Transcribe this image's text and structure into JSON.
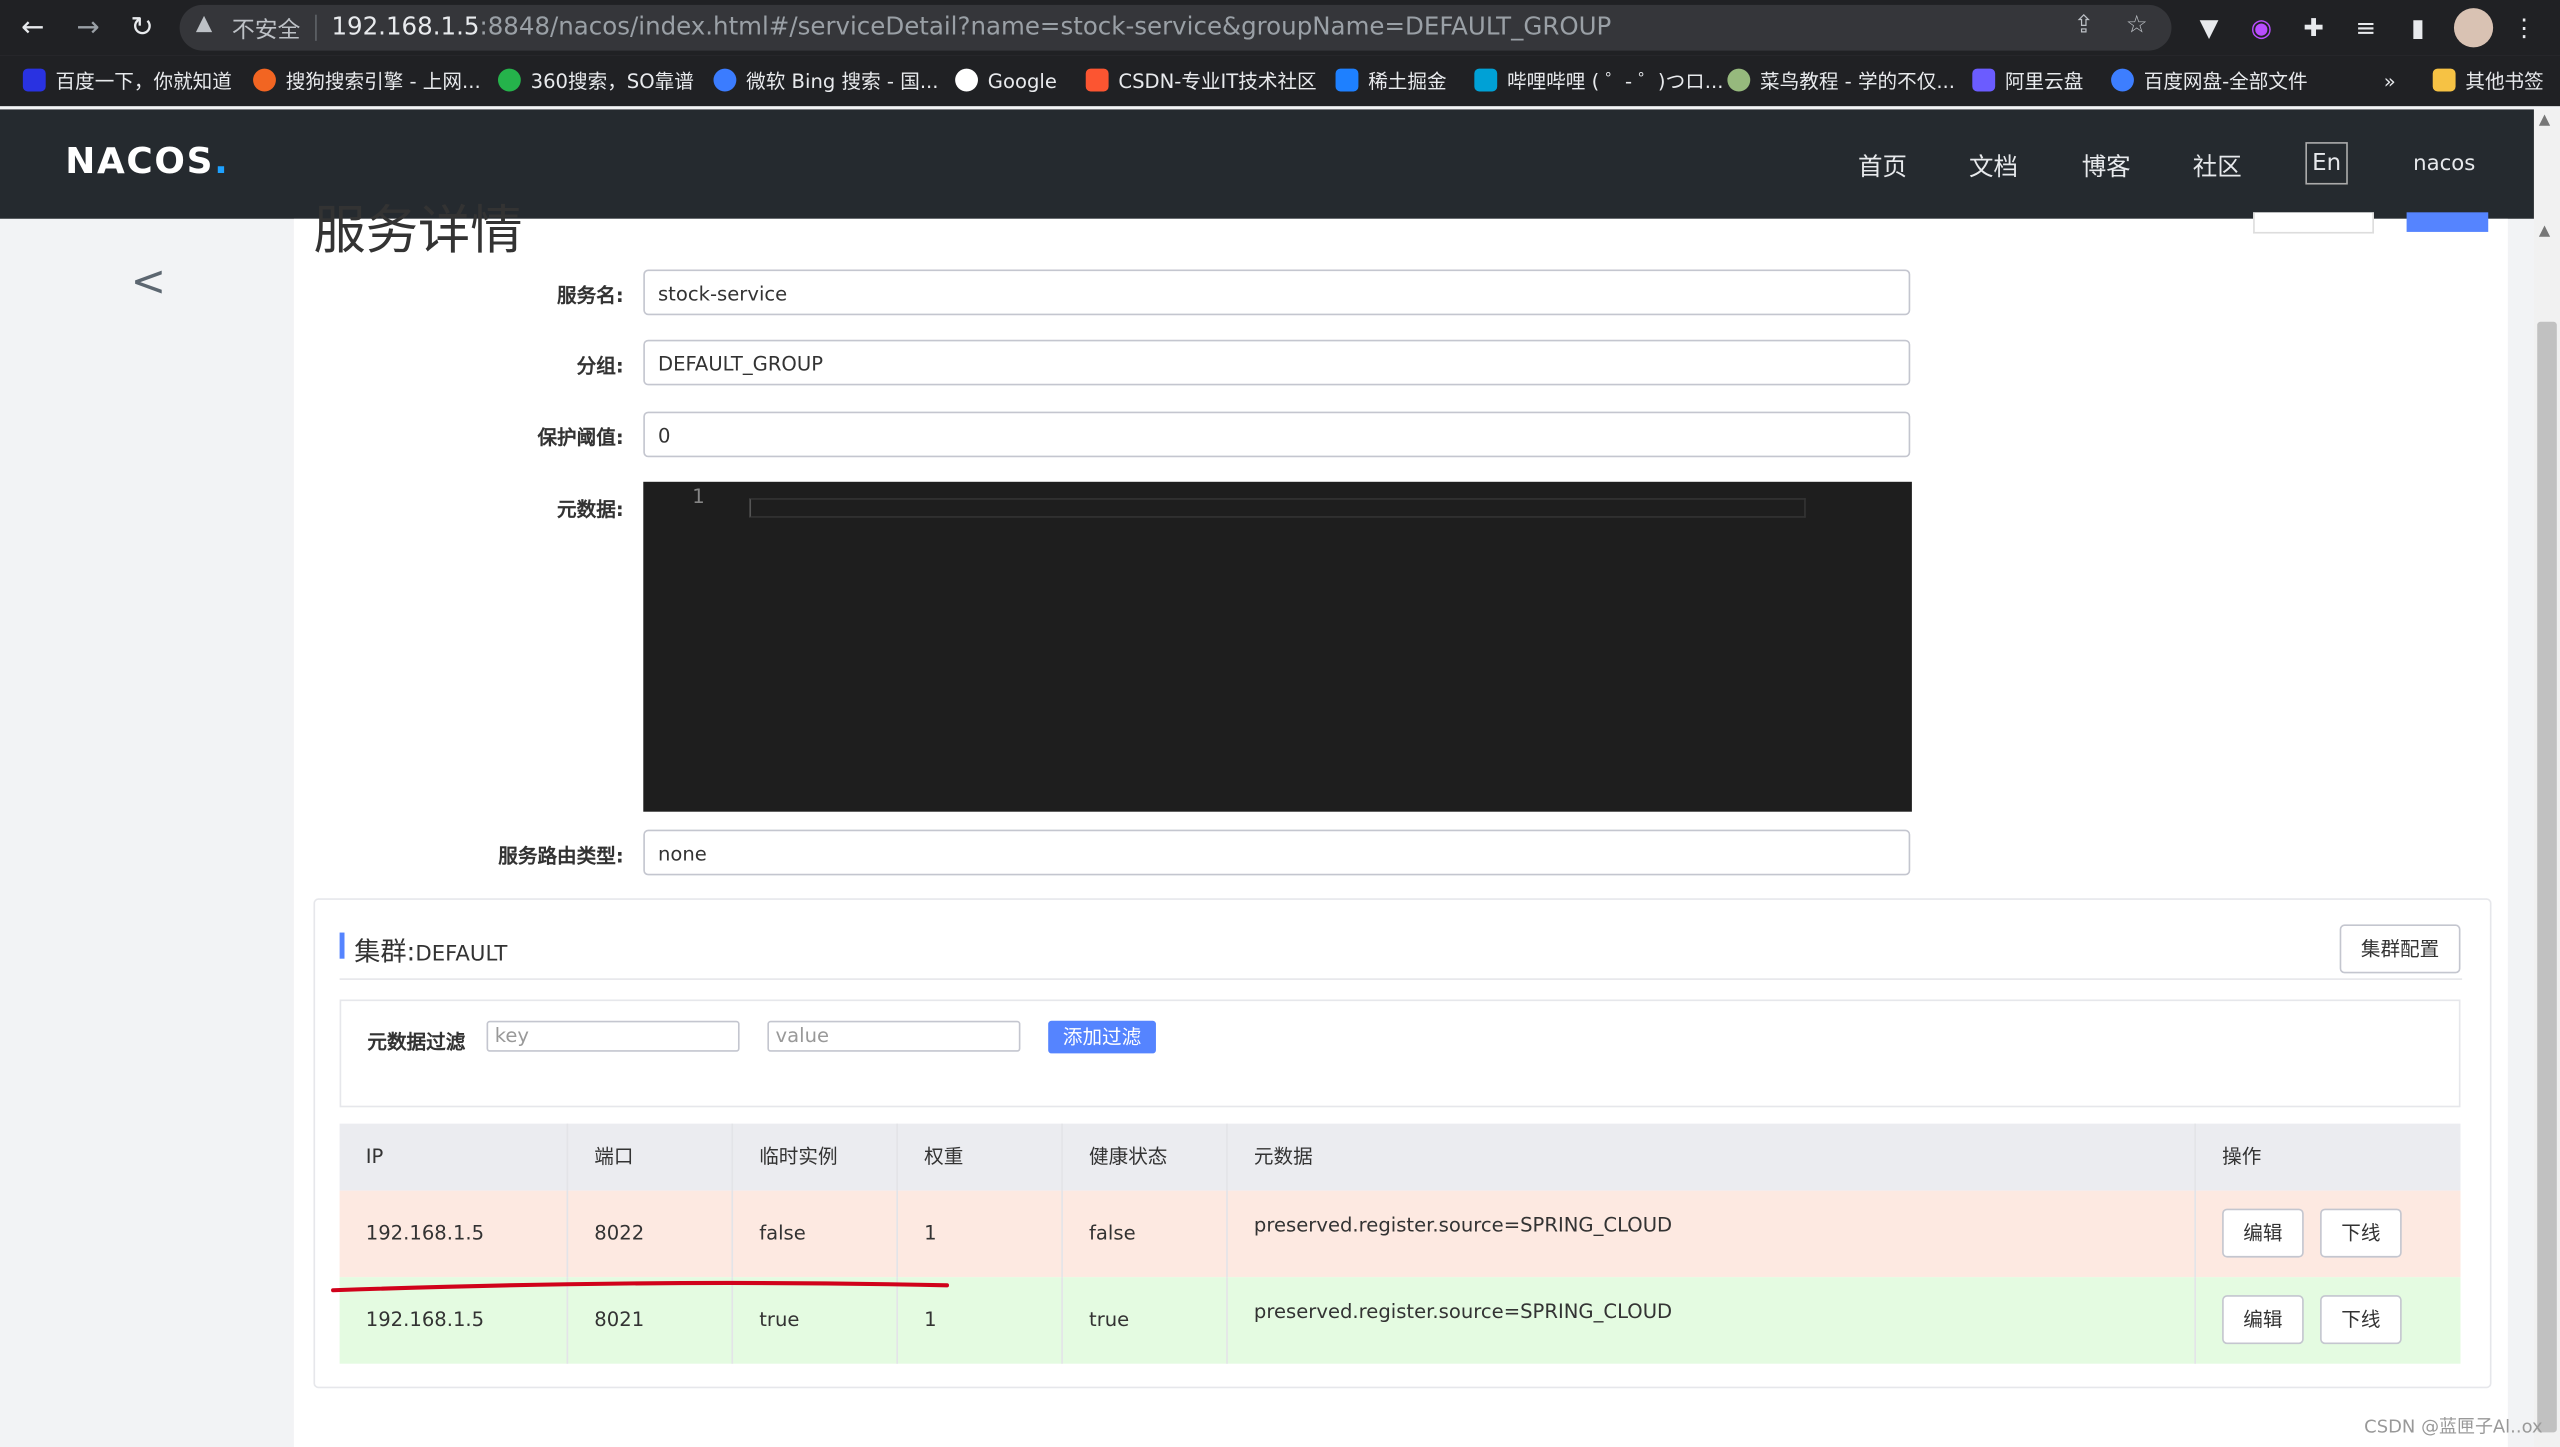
{
  "browser": {
    "insecure_label": "不安全",
    "url_host": "192.168.1.5",
    "url_rest": ":8848/nacos/index.html#/serviceDetail?name=stock-service&groupName=DEFAULT_GROUP",
    "bookmarks": [
      "百度一下，你就知道",
      "搜狗搜索引擎 - 上网...",
      "360搜索，SO靠谱",
      "微软 Bing 搜索 - 国...",
      "Google",
      "CSDN-专业IT技术社区",
      "稀土掘金",
      "哔哩哔哩 ( ゜- ゜)つロ...",
      "菜鸟教程 - 学的不仅...",
      "阿里云盘",
      "百度网盘-全部文件",
      "»",
      "其他书签"
    ]
  },
  "header": {
    "logo": "NACOS",
    "logo_dot": ".",
    "nav": [
      "首页",
      "文档",
      "博客",
      "社区"
    ],
    "lang": "En",
    "user": "nacos"
  },
  "page": {
    "title": "服务详情"
  },
  "form": {
    "service_name_label": "服务名:",
    "service_name": "stock-service",
    "group_label": "分组:",
    "group": "DEFAULT_GROUP",
    "protect_label": "保护阈值:",
    "protect": "0",
    "metadata_label": "元数据:",
    "editor_line_number": "1",
    "selector_label": "服务路由类型:",
    "selector": "none"
  },
  "cluster": {
    "title": "集群:",
    "name": "DEFAULT",
    "config_button": "集群配置",
    "filter_label": "元数据过滤",
    "key_placeholder": "key",
    "value_placeholder": "value",
    "add_filter": "添加过滤"
  },
  "table": {
    "headers": [
      "IP",
      "端口",
      "临时实例",
      "权重",
      "健康状态",
      "元数据",
      "操作"
    ],
    "rows": [
      {
        "ip": "192.168.1.5",
        "port": "8022",
        "ephemeral": "false",
        "weight": "1",
        "healthy": "false",
        "metadata": "preserved.register.source=SPRING_CLOUD",
        "edit": "编辑",
        "offline": "下线",
        "bg": "#fde9e1"
      },
      {
        "ip": "192.168.1.5",
        "port": "8021",
        "ephemeral": "true",
        "weight": "1",
        "healthy": "true",
        "metadata": "preserved.register.source=SPRING_CLOUD",
        "edit": "编辑",
        "offline": "下线",
        "bg": "#e4fbe1"
      }
    ]
  },
  "watermark": "CSDN @蓝匣子Al..ox",
  "colors": {
    "accent": "#5584ff",
    "header_bg": "#252a2f",
    "annotation": "#d0021b"
  }
}
